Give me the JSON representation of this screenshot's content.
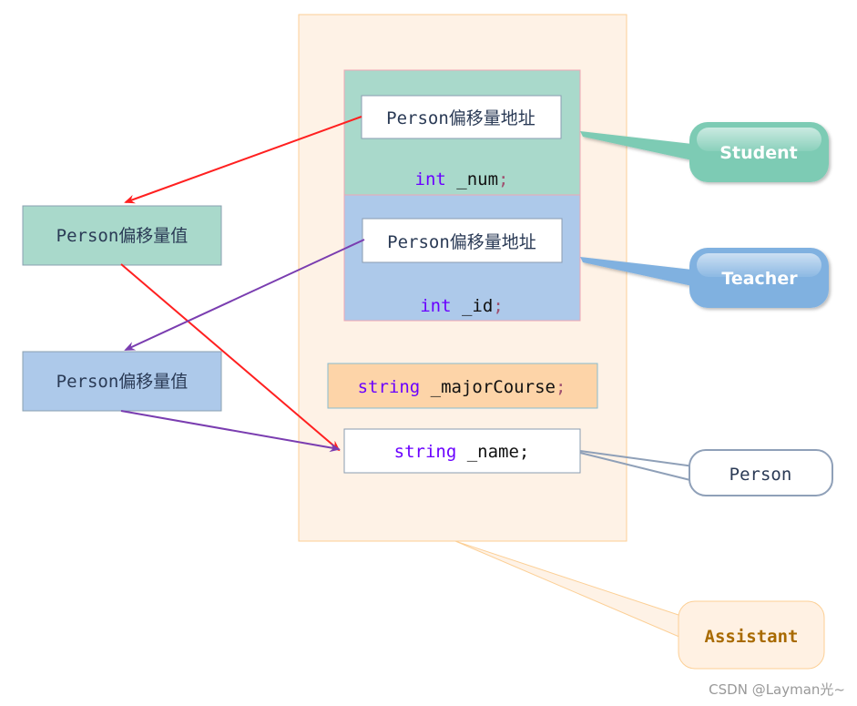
{
  "colors": {
    "student": "#7dcbb4",
    "teacher": "#80b1e0",
    "assistant_bg": "#fef2e6",
    "major": "#fdd4a8",
    "keyword": "#6a00ff",
    "arrow_red": "#ff2020",
    "arrow_purple": "#7a3db0"
  },
  "student": {
    "vbptr_label": "Person偏移量地址",
    "member_type": "int",
    "member_name": " _num",
    "semicolon": ";"
  },
  "teacher": {
    "vbptr_label": "Person偏移量地址",
    "member_type": "int",
    "member_name": " _id",
    "semicolon": ";"
  },
  "assistant_member": {
    "type": "string",
    "name": " _majorCourse",
    "semicolon": ";"
  },
  "person_member": {
    "type": "string",
    "name": " _name;"
  },
  "offset_tables": [
    {
      "label": "Person偏移量值"
    },
    {
      "label": "Person偏移量值"
    }
  ],
  "callouts": {
    "student": "Student",
    "teacher": "Teacher",
    "person": "Person",
    "assistant": "Assistant"
  },
  "watermark": "CSDN @Layman光~"
}
